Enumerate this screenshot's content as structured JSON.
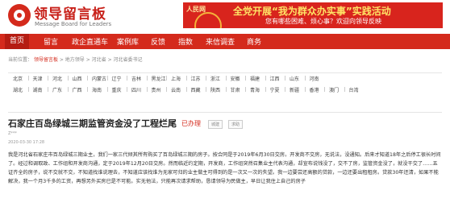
{
  "header": {
    "logo_cn": "领导留言板",
    "logo_en": "Message Board for Leaders",
    "banner_brand": "人民网",
    "banner_line1": "全党开展“我为群众办实事”实践活动",
    "banner_line2": "您有哪些困难、烦心事？欢迎向领导反映"
  },
  "nav": [
    "首页",
    "留言",
    "政企直通车",
    "案例库",
    "反馈",
    "指数",
    "来信调查",
    "商务"
  ],
  "breadcrumb": [
    "当前位置：",
    "领导留言板",
    "地方领导",
    "河北省",
    "河北省委书记"
  ],
  "regions": {
    "row1": [
      "北京",
      "天津",
      "河北",
      "山西",
      "内蒙古",
      "辽宁",
      "吉林",
      "黑龙江",
      "上海",
      "江苏",
      "浙江",
      "安徽",
      "福建",
      "江西",
      "山东",
      "河南"
    ],
    "row2": [
      "湖北",
      "湖南",
      "广东",
      "广西",
      "海南",
      "重庆",
      "四川",
      "贵州",
      "云南",
      "西藏",
      "陕西",
      "甘肃",
      "青海",
      "宁夏",
      "新疆",
      "香港",
      "澳门",
      "台湾"
    ]
  },
  "post": {
    "title": "石家庄百岛绿城三期监管资金没了工程烂尾",
    "status": "已办理",
    "tag1": "城建",
    "tag2": "求助",
    "author": "Z***",
    "time": "2020-03-30 17:28",
    "body": "我是河北省石家庄市百岛绿城三期业主，我们一家三代倾其所有购买了百岛绿城三期的房子。按合同是于2019年6月30日交房。开发商不交房，无说法，没通知。后来才知道18年之后停工很长时间了。经过和调取政、工作组和开发商沟通，定于2019年12月20日交房。然而临近约定期，开发商，工作组突然召集业主代表沟通，却宣布说钱没了，交不了房，监管资金没了，就没干交了……五证齐全的房子，说不交就不交，不知道找谁说理去，不知道应该找谁为无家可归的业主做主可得到的是一次又一次的失望。我一边要尝还高额的贷款，一边还要出租租房。贷款30年还清，如果不能解决，我一个月3千多的工资，再想另外买房已是不可能。实无他法，只能再次请求帮助，恳请领导为民做主，早日让我住上自己的房子"
  },
  "colors": {
    "brand_red": "#d42a1c",
    "banner_yellow": "#ffe566"
  }
}
